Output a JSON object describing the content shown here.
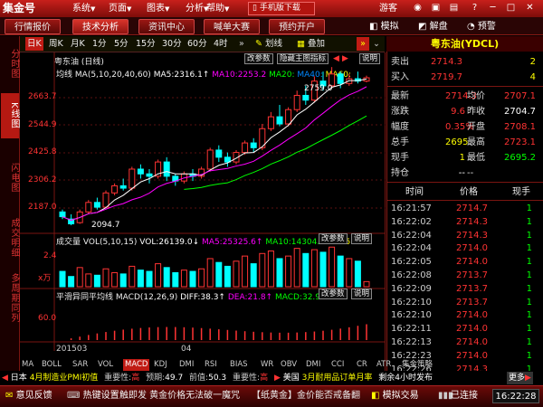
{
  "app": {
    "logo": "集金号",
    "menus": [
      "系统",
      "页面",
      "图表",
      "分析",
      "帮助"
    ],
    "mobile_btn": "手机版下载",
    "user": "游客"
  },
  "tabs": [
    "行情报价",
    "技术分析",
    "资讯中心",
    "喊单大赛",
    "预约开户"
  ],
  "right_tabs": [
    "模拟",
    "解盘",
    "预警"
  ],
  "toolbar": {
    "items": [
      "日K",
      "周K",
      "月K",
      "1分",
      "5分",
      "15分",
      "30分",
      "60分",
      "4时"
    ],
    "draw": "划线",
    "overlay": "叠加",
    "active": "日K"
  },
  "left_nav": [
    "分时图",
    "K线图",
    "闪电图",
    "成交明细",
    "多周期同列"
  ],
  "chart": {
    "title": "粤东油 (日线)",
    "legend_name": "均线",
    "ma_params": "MA(5,10,20,40,60)",
    "ma5": "MA5:2316.1↑",
    "ma10": "MA10:2253.2",
    "ma20": "MA20:",
    "ma40": "MA40:",
    "ma60": "MA60:",
    "btn_change": "改参数",
    "btn_hide": "隐藏主图指标",
    "btn_help": "说明",
    "price_ticks": [
      "2663.7",
      "2544.9",
      "2425.8",
      "2306.2",
      "2187.0"
    ],
    "high_label": "2759.0",
    "low_label": "2094.7",
    "vol_title": "成交量",
    "vol_params": "VOL(5,10,15)",
    "vol_value": "VOL:26139.0↓",
    "vol_ma5": "MA5:25325.6↑",
    "vol_ma10": "MA10:14304.9",
    "vol_ma15": "MA15:1",
    "vol_tick": "2.4",
    "vol_mult": "x万",
    "macd_title": "平滑异同平均线",
    "macd_params": "MACD(12,26,9)",
    "macd_diff": "DIFF:38.3↑",
    "macd_dea": "DEA:21.8↑",
    "macd_val": "MACD:32.9↓",
    "macd_tick": "60.0",
    "date_left": "201503",
    "date_mid": "04",
    "colors": {
      "up": "#ff3333",
      "down": "#00ffff",
      "ma5": "#ffffff",
      "ma10": "#ff00ff",
      "ma20": "#00ff00",
      "ma40": "#0080ff",
      "ma60": "#ffff00"
    }
  },
  "quote": {
    "name": "粤东油(YDCL)",
    "sell_label": "卖出",
    "sell_price": "2714.3",
    "sell_vol": "2",
    "buy_label": "买入",
    "buy_price": "2719.7",
    "buy_vol": "4",
    "rows": [
      {
        "l1": "最新",
        "v1": "2714.3",
        "l2": "均价",
        "v2": "2707.1",
        "c1": "#ff3333",
        "c2": "#ff3333"
      },
      {
        "l1": "涨跌",
        "v1": "9.6",
        "l2": "昨收",
        "v2": "2704.7",
        "c1": "#ff3333",
        "c2": "#ffffff"
      },
      {
        "l1": "幅度",
        "v1": "0.35%",
        "l2": "开盘",
        "v2": "2708.1",
        "c1": "#ff3333",
        "c2": "#ff3333"
      },
      {
        "l1": "总手",
        "v1": "2695",
        "l2": "最高",
        "v2": "2723.1",
        "c1": "#ffff00",
        "c2": "#ff3333"
      },
      {
        "l1": "现手",
        "v1": "1",
        "l2": "最低",
        "v2": "2695.2",
        "c1": "#ffff00",
        "c2": "#00ff00"
      },
      {
        "l1": "持仓",
        "v1": "--",
        "l2": "--",
        "v2": "",
        "c1": "#ffffff",
        "c2": "#ffffff"
      }
    ],
    "trade_headers": [
      "时间",
      "价格",
      "现手"
    ],
    "trades": [
      {
        "t": "16:21:57",
        "p": "2714.7",
        "v": "1"
      },
      {
        "t": "16:22:02",
        "p": "2714.3",
        "v": "1"
      },
      {
        "t": "16:22:04",
        "p": "2714.3",
        "v": "1"
      },
      {
        "t": "16:22:04",
        "p": "2714.0",
        "v": "1"
      },
      {
        "t": "16:22:05",
        "p": "2714.0",
        "v": "1"
      },
      {
        "t": "16:22:08",
        "p": "2713.7",
        "v": "1"
      },
      {
        "t": "16:22:09",
        "p": "2713.7",
        "v": "1"
      },
      {
        "t": "16:22:10",
        "p": "2713.7",
        "v": "1"
      },
      {
        "t": "16:22:10",
        "p": "2714.0",
        "v": "1"
      },
      {
        "t": "16:22:11",
        "p": "2714.0",
        "v": "1"
      },
      {
        "t": "16:22:13",
        "p": "2714.0",
        "v": "1"
      },
      {
        "t": "16:22:23",
        "p": "2714.0",
        "v": "1"
      },
      {
        "t": "16:22:26",
        "p": "2714.3",
        "v": "1"
      }
    ]
  },
  "indicators": [
    "MA",
    "BOLL",
    "SAR",
    "VOL",
    "MACD",
    "KDJ",
    "DMI",
    "RSI",
    "BIAS",
    "WR",
    "OBV",
    "DMI",
    "CCI",
    "CR",
    "ATR",
    "集金策略"
  ],
  "active_indicator": "MACD",
  "ticker": {
    "t1_country": "日本",
    "t1_text": "4月制造业PMI初值",
    "t1_imp": "重要性:",
    "t1_imp_v": "高",
    "t1_exp": "预期:",
    "t1_exp_v": "49.7",
    "t1_prev": "前值:",
    "t1_prev_v": "50.3",
    "t2_country": "美国",
    "t2_text": "3月耐用品订单月率",
    "t2_next": "剩余4小时发布",
    "more": "更多"
  },
  "status": {
    "feedback": "意见反馈",
    "hotkey": "热键设置",
    "news": "触即发 黄金价格无法破一魔咒",
    "news2": "【纸黄金】金价能否戒备翻",
    "sim": "模拟交易",
    "conn": "已连接",
    "time": "16:22:28"
  }
}
